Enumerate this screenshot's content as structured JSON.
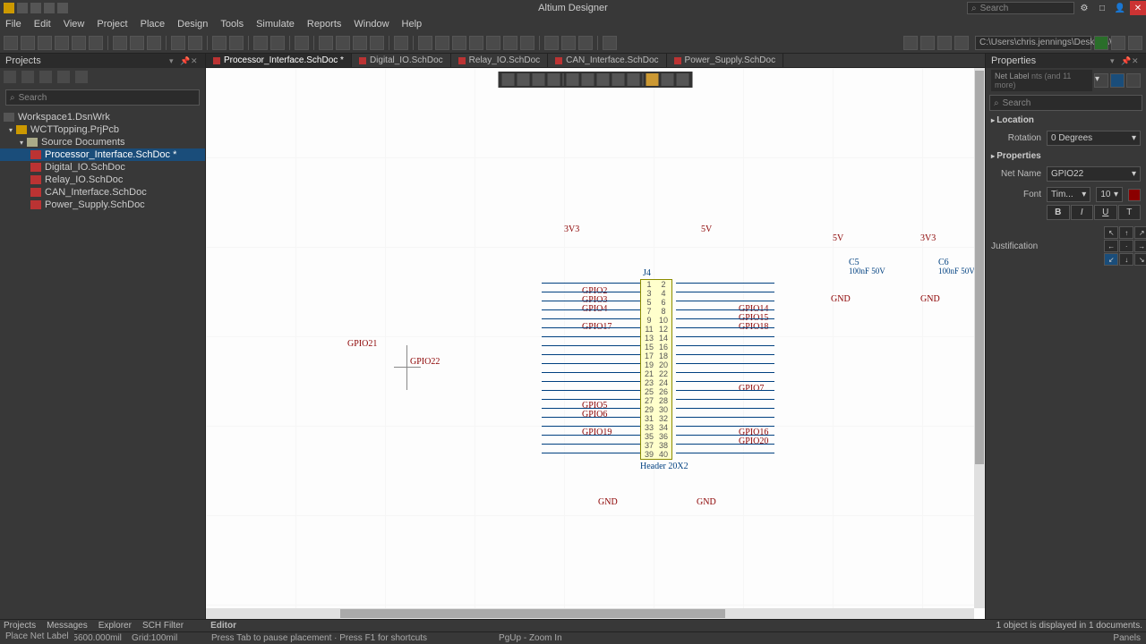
{
  "app": {
    "title": "Altium Designer"
  },
  "search": {
    "placeholder": "Search"
  },
  "menu": [
    "File",
    "Edit",
    "View",
    "Project",
    "Place",
    "Design",
    "Tools",
    "Simulate",
    "Reports",
    "Window",
    "Help"
  ],
  "toolbar_path": "C:\\Users\\chris.jennings\\Desktop\\W",
  "doc_tabs": [
    {
      "label": "Processor_Interface.SchDoc *",
      "active": true
    },
    {
      "label": "Digital_IO.SchDoc",
      "active": false
    },
    {
      "label": "Relay_IO.SchDoc",
      "active": false
    },
    {
      "label": "CAN_Interface.SchDoc",
      "active": false
    },
    {
      "label": "Power_Supply.SchDoc",
      "active": false
    }
  ],
  "projects_panel": {
    "title": "Projects",
    "search": "Search",
    "tree": {
      "workspace": "Workspace1.DsnWrk",
      "project": "WCTTopping.PrjPcb",
      "folder": "Source Documents",
      "docs": [
        {
          "name": "Processor_Interface.SchDoc *",
          "sel": true
        },
        {
          "name": "Digital_IO.SchDoc",
          "sel": false
        },
        {
          "name": "Relay_IO.SchDoc",
          "sel": false
        },
        {
          "name": "CAN_Interface.SchDoc",
          "sel": false
        },
        {
          "name": "Power_Supply.SchDoc",
          "sel": false
        }
      ]
    }
  },
  "schematic": {
    "placing_label": "GPIO22",
    "placed_label": "GPIO21",
    "v3v3": "3V3",
    "v5": "5V",
    "gnd": "GND",
    "j4": "J4",
    "header_desc": "Header 20X2",
    "c5": "C5",
    "c6": "C6",
    "cap_val": "100nF 50V",
    "left_labels": [
      "GPIO2",
      "GPIO3",
      "GPIO4",
      "GPIO17",
      "GPIO5",
      "GPIO6",
      "GPIO19"
    ],
    "right_labels": [
      "GPIO14",
      "GPIO15",
      "GPIO18",
      "GPIO7",
      "GPIO16",
      "GPIO20"
    ]
  },
  "properties": {
    "title": "Properties",
    "mode_label": "nts (and 11 more)",
    "mode_prefix": "Net Label",
    "search": "Search",
    "sections": {
      "location": "Location",
      "properties": "Properties"
    },
    "rotation_label": "Rotation",
    "rotation_value": "0 Degrees",
    "netname_label": "Net Name",
    "netname_value": "GPIO22",
    "font_label": "Font",
    "font_family": "Tim...",
    "font_size": "10",
    "bold": "B",
    "italic": "I",
    "underline": "U",
    "strike": "T",
    "justification_label": "Justification"
  },
  "bottom_tabs_left": [
    "Projects",
    "Messages",
    "Explorer",
    "SCH Filter"
  ],
  "bottom_editor": "Editor",
  "bottom_right_msg": "1 object is displayed in 1 documents.",
  "status": {
    "coords": "X:4200.000mil Y:5600.000mil",
    "grid": "Grid:100mil",
    "hint": "Press Tab to pause placement · Press F1 for shortcuts",
    "zoom": "PgUp - Zoom In"
  },
  "footer": "Place Net Label",
  "footer_right": "Panels"
}
